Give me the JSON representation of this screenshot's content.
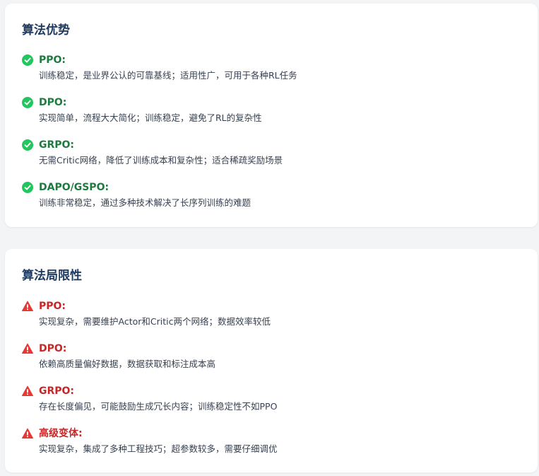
{
  "advantages": {
    "title": "算法优势",
    "icon": "check-circle-icon",
    "color": "#22c55e",
    "items": [
      {
        "name": "PPO:",
        "desc": "训练稳定，是业界公认的可靠基线；适用性广，可用于各种RL任务"
      },
      {
        "name": "DPO:",
        "desc": "实现简单，流程大大简化；训练稳定，避免了RL的复杂性"
      },
      {
        "name": "GRPO:",
        "desc": "无需Critic网络，降低了训练成本和复杂性；适合稀疏奖励场景"
      },
      {
        "name": "DAPO/GSPO:",
        "desc": "训练非常稳定，通过多种技术解决了长序列训练的难题"
      }
    ]
  },
  "limitations": {
    "title": "算法局限性",
    "icon": "warning-triangle-icon",
    "color": "#e53935",
    "items": [
      {
        "name": "PPO:",
        "desc": "实现复杂，需要维护Actor和Critic两个网络；数据效率较低"
      },
      {
        "name": "DPO:",
        "desc": "依赖高质量偏好数据，数据获取和标注成本高"
      },
      {
        "name": "GRPO:",
        "desc": "存在长度偏见，可能鼓励生成冗长内容；训练稳定性不如PPO"
      },
      {
        "name": "高级变体:",
        "desc": "实现复杂，集成了多种工程技巧；超参数较多，需要仔细调优"
      }
    ]
  }
}
